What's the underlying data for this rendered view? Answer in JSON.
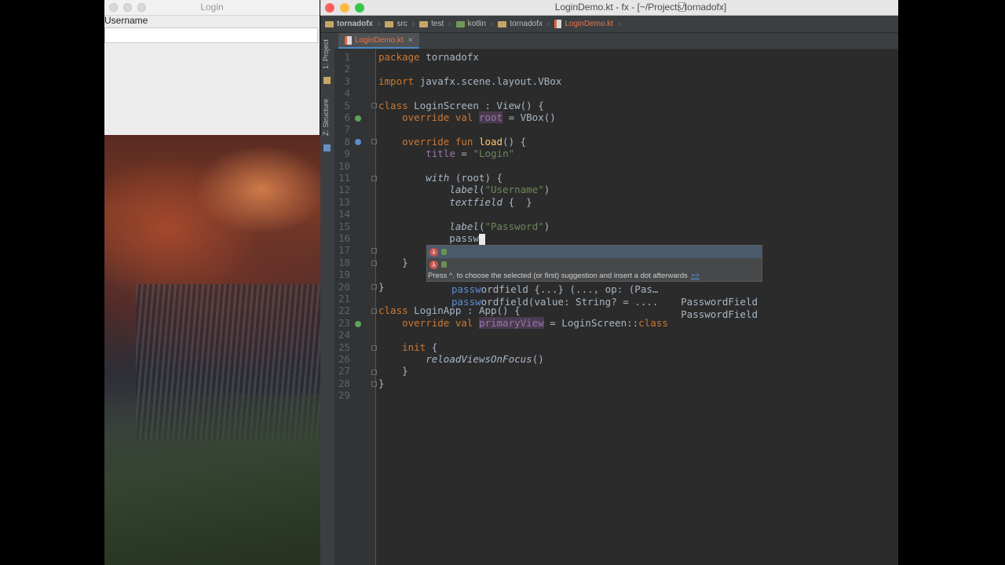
{
  "login_window": {
    "title": "Login",
    "username_label": "Username",
    "username_value": ""
  },
  "ide": {
    "title": "LoginDemo.kt - fx - [~/Projects/tornadofx]",
    "breadcrumbs": [
      "tornadofx",
      "src",
      "test",
      "kotlin",
      "tornadofx",
      "LoginDemo.kt"
    ],
    "tab_label": "LoginDemo.kt",
    "tab_close": "×",
    "side_tools": [
      "1: Project",
      "Z: Structure"
    ],
    "line_numbers": [
      "1",
      "2",
      "3",
      "4",
      "5",
      "6",
      "7",
      "8",
      "9",
      "10",
      "11",
      "12",
      "13",
      "14",
      "15",
      "16",
      "17",
      "18",
      "19",
      "20",
      "21",
      "22",
      "23",
      "24",
      "25",
      "26",
      "27",
      "28",
      "29"
    ],
    "code": {
      "l1a": "package ",
      "l1b": "tornadofx",
      "l3a": "import ",
      "l3b": "javafx.scene.layout.VBox",
      "l5a": "class ",
      "l5b": "LoginScreen : View() {",
      "l6a": "    override val ",
      "l6b": "root",
      "l6c": " = VBox()",
      "l8a": "    override fun ",
      "l8b": "load",
      "l8c": "() {",
      "l9a": "        ",
      "l9b": "title",
      "l9c": " = ",
      "l9d": "\"Login\"",
      "l11a": "        ",
      "l11b": "with",
      "l11c": " (root) {",
      "l12a": "            ",
      "l12b": "label",
      "l12c": "(",
      "l12d": "\"Username\"",
      "l12e": ")",
      "l13a": "            ",
      "l13b": "textfield",
      "l13c": " {  }",
      "l15a": "            ",
      "l15b": "label",
      "l15c": "(",
      "l15d": "\"Password\"",
      "l15e": ")",
      "l16a": "            passw",
      "l18": "    }",
      "l20": "}",
      "l22a": "class ",
      "l22b": "LoginApp : App() {",
      "l23a": "    override val ",
      "l23b": "primaryView",
      "l23c": " = LoginScreen::",
      "l23d": "class",
      "l25a": "    ",
      "l25b": "init",
      "l25c": " {",
      "l26a": "        ",
      "l26b": "reloadViewsOnFocus",
      "l26c": "()",
      "l27": "    }",
      "l28": "}"
    },
    "completion": {
      "items": [
        {
          "match": "passw",
          "rest": "ordfield {...} (..., op: (Pas…",
          "type": "PasswordField"
        },
        {
          "match": "passw",
          "rest": "ordfield(value: String? = ....",
          "type": "PasswordField"
        }
      ],
      "hint": "Press ^. to choose the selected (or first) suggestion and insert a dot afterwards",
      "hint_link": ">>"
    }
  },
  "colors": {
    "keyword": "#cc7832",
    "string": "#6a8759",
    "function": "#ffc66d",
    "property": "#9876aa",
    "text": "#a9b7c6",
    "editor_bg": "#2b2b2b"
  }
}
